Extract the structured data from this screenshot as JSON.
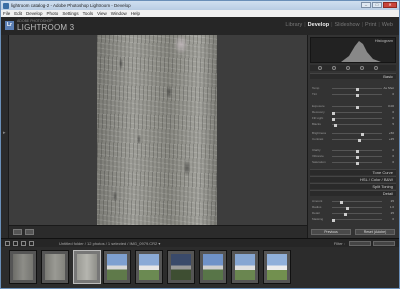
{
  "window": {
    "title": "lightroom catalog-2 - Adobe Photoshop Lightroom - Develop",
    "controls": [
      "–",
      "□",
      "✕"
    ]
  },
  "menu": [
    "File",
    "Edit",
    "Develop",
    "Photo",
    "Settings",
    "Tools",
    "View",
    "Window",
    "Help"
  ],
  "identity": {
    "logo": "Lr",
    "subtitle": "ADOBE PHOTOSHOP",
    "product": "LIGHTROOM 3"
  },
  "modules": {
    "library": "Library",
    "develop": "Develop",
    "slideshow": "Slideshow",
    "print": "Print",
    "web": "Web",
    "separator": "|"
  },
  "histogram": {
    "title": "Histogram",
    "color": "#9a9a9a"
  },
  "sections": {
    "basic": "Basic",
    "tone_curve": "Tone Curve",
    "hsl": "HSL / Color / B&W",
    "split_toning": "Split Toning",
    "detail": "Detail"
  },
  "sliders": {
    "temp": {
      "label": "Temp",
      "value": "As Shot",
      "pos": 0.5
    },
    "tint": {
      "label": "Tint",
      "value": "0",
      "pos": 0.5
    },
    "exposure": {
      "label": "Exposure",
      "value": "0.00",
      "pos": 0.5
    },
    "recovery": {
      "label": "Recovery",
      "value": "0",
      "pos": 0.0
    },
    "fill_light": {
      "label": "Fill Light",
      "value": "0",
      "pos": 0.0
    },
    "blacks": {
      "label": "Blacks",
      "value": "5",
      "pos": 0.05
    },
    "brightness": {
      "label": "Brightness",
      "value": "+50",
      "pos": 0.62
    },
    "contrast": {
      "label": "Contrast",
      "value": "+25",
      "pos": 0.56
    },
    "clarity": {
      "label": "Clarity",
      "value": "0",
      "pos": 0.5
    },
    "vibrance": {
      "label": "Vibrance",
      "value": "0",
      "pos": 0.5
    },
    "saturation": {
      "label": "Saturation",
      "value": "0",
      "pos": 0.5
    },
    "amount": {
      "label": "Amount",
      "value": "25",
      "pos": 0.17
    },
    "radius": {
      "label": "Radius",
      "value": "1.0",
      "pos": 0.3
    },
    "detail": {
      "label": "Detail",
      "value": "25",
      "pos": 0.25
    },
    "masking": {
      "label": "Masking",
      "value": "0",
      "pos": 0.0
    }
  },
  "buttons": {
    "previous": "Previous",
    "reset": "Reset (Adobe)"
  },
  "filmstrip_bar": {
    "path": "Untitled folder / 12 photos / 1 selected / IMG_0979.CR2 ▾",
    "filter_label": "Filter :"
  },
  "filmstrip": {
    "thumbnails": [
      {
        "name": "thumb-1",
        "selected": false
      },
      {
        "name": "thumb-2",
        "selected": false
      },
      {
        "name": "thumb-3",
        "selected": true
      },
      {
        "name": "thumb-4",
        "selected": false
      },
      {
        "name": "thumb-5",
        "selected": false
      },
      {
        "name": "thumb-6",
        "selected": false
      },
      {
        "name": "thumb-7",
        "selected": false
      },
      {
        "name": "thumb-8",
        "selected": false
      },
      {
        "name": "thumb-9",
        "selected": false
      }
    ]
  }
}
